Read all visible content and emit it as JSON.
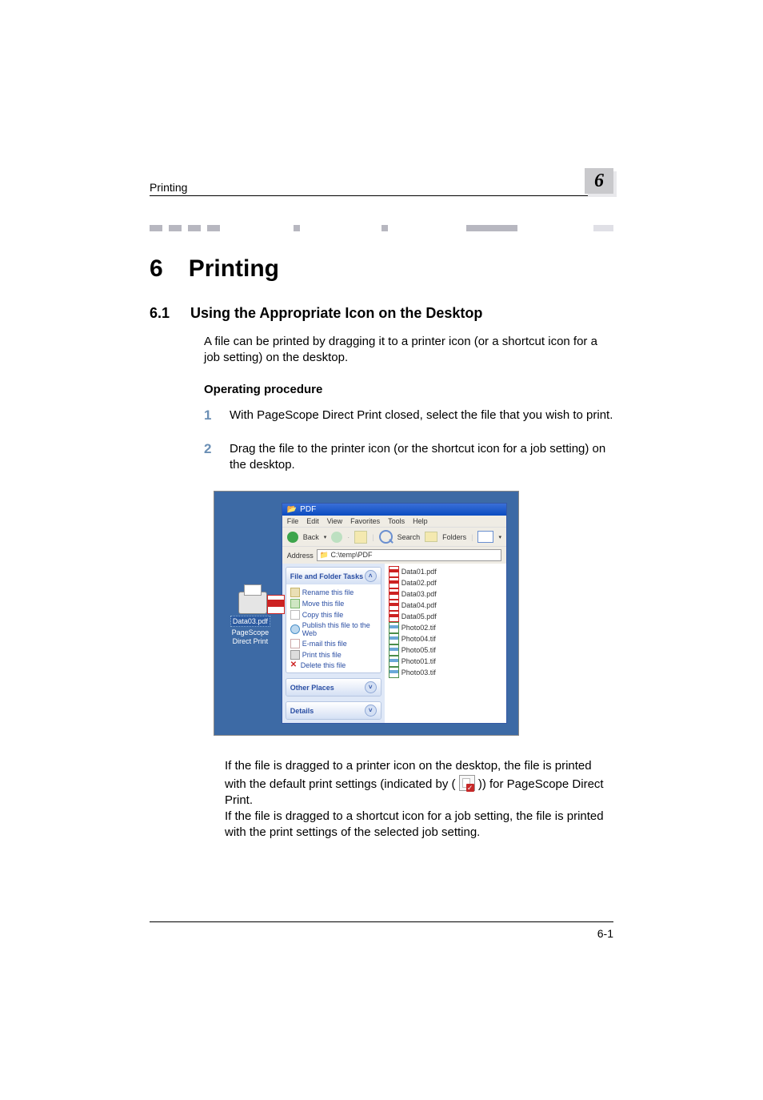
{
  "running_header": {
    "title": "Printing",
    "chapter": "6"
  },
  "heading1": {
    "num": "6",
    "text": "Printing"
  },
  "heading2": {
    "num": "6.1",
    "text": "Using the Appropriate Icon on the Desktop"
  },
  "intro": "A file can be printed by dragging it to a printer icon (or a shortcut icon for a job setting) on the desktop.",
  "subhead": "Operating procedure",
  "steps": [
    {
      "num": "1",
      "text": "With PageScope Direct Print closed, select the file that you wish to print."
    },
    {
      "num": "2",
      "text": "Drag the file to the printer icon (or the shortcut icon for a job setting) on the desktop."
    }
  ],
  "desktop": {
    "dragged_file": "Data03.pdf",
    "target_label": "PageScope Direct Print"
  },
  "explorer": {
    "title_icon": "folder-icon",
    "title": "PDF",
    "menu": [
      "File",
      "Edit",
      "View",
      "Favorites",
      "Tools",
      "Help"
    ],
    "toolbar": {
      "back": "Back",
      "search": "Search",
      "folders": "Folders"
    },
    "address_label": "Address",
    "address_value": "C:\\temp\\PDF",
    "task_groups": [
      {
        "title": "File and Folder Tasks",
        "expanded": true,
        "items": [
          {
            "icon": "rename",
            "label": "Rename this file"
          },
          {
            "icon": "move",
            "label": "Move this file"
          },
          {
            "icon": "copy",
            "label": "Copy this file"
          },
          {
            "icon": "web",
            "label": "Publish this file to the Web"
          },
          {
            "icon": "email",
            "label": "E-mail this file"
          },
          {
            "icon": "print",
            "label": "Print this file"
          },
          {
            "icon": "delete",
            "label": "Delete this file"
          }
        ]
      },
      {
        "title": "Other Places",
        "expanded": false
      },
      {
        "title": "Details",
        "expanded": false
      }
    ],
    "files": [
      {
        "name": "Data01.pdf",
        "type": "pdf"
      },
      {
        "name": "Data02.pdf",
        "type": "pdf"
      },
      {
        "name": "Data03.pdf",
        "type": "pdf"
      },
      {
        "name": "Data04.pdf",
        "type": "pdf"
      },
      {
        "name": "Data05.pdf",
        "type": "pdf"
      },
      {
        "name": "Photo02.tif",
        "type": "tif"
      },
      {
        "name": "Photo04.tif",
        "type": "tif"
      },
      {
        "name": "Photo05.tif",
        "type": "tif"
      },
      {
        "name": "Photo01.tif",
        "type": "tif"
      },
      {
        "name": "Photo03.tif",
        "type": "tif"
      }
    ]
  },
  "results": {
    "p1a": "If the file is dragged to a printer icon on the desktop, the file is printed with the default print settings (indicated by (",
    "p1b": ")) for PageScope Direct Print.",
    "p2": "If the file is dragged to a shortcut icon for a job setting, the file is printed with the print settings of the selected job setting."
  },
  "footer": {
    "page": "6-1"
  }
}
